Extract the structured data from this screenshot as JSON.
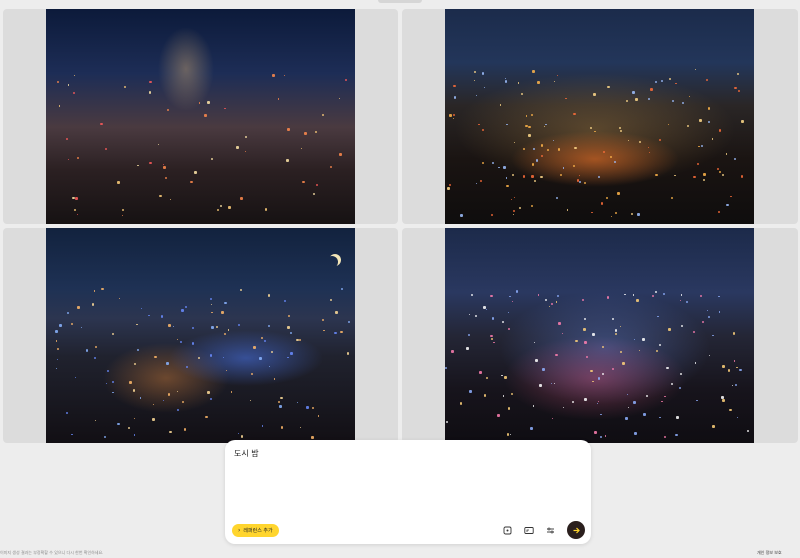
{
  "gallery": {
    "images": [
      {
        "alt": "night city street with yellow taxis",
        "icon": "image-icon"
      },
      {
        "alt": "aerial night city with light trails",
        "icon": "image-icon"
      },
      {
        "alt": "night river city with crescent moon",
        "icon": "image-icon"
      },
      {
        "alt": "night skyline with light streaks",
        "icon": "image-icon"
      }
    ]
  },
  "composer": {
    "prompt": "도시 밤",
    "reference_label": "레퍼런스 추가",
    "tools": [
      {
        "name": "crop-icon"
      },
      {
        "name": "aspect-ratio-icon"
      },
      {
        "name": "settings-sliders-icon"
      }
    ],
    "send_icon": "arrow-right-icon"
  },
  "footer": {
    "note": "이미지 생성 결과는 부정확할 수 있으니 다시 한번 확인하세요.",
    "links": [
      "개인 정보 보호"
    ]
  },
  "colors": {
    "accent": "#ffd52e",
    "send_button": "#2a1f1d",
    "background": "#ededed"
  }
}
